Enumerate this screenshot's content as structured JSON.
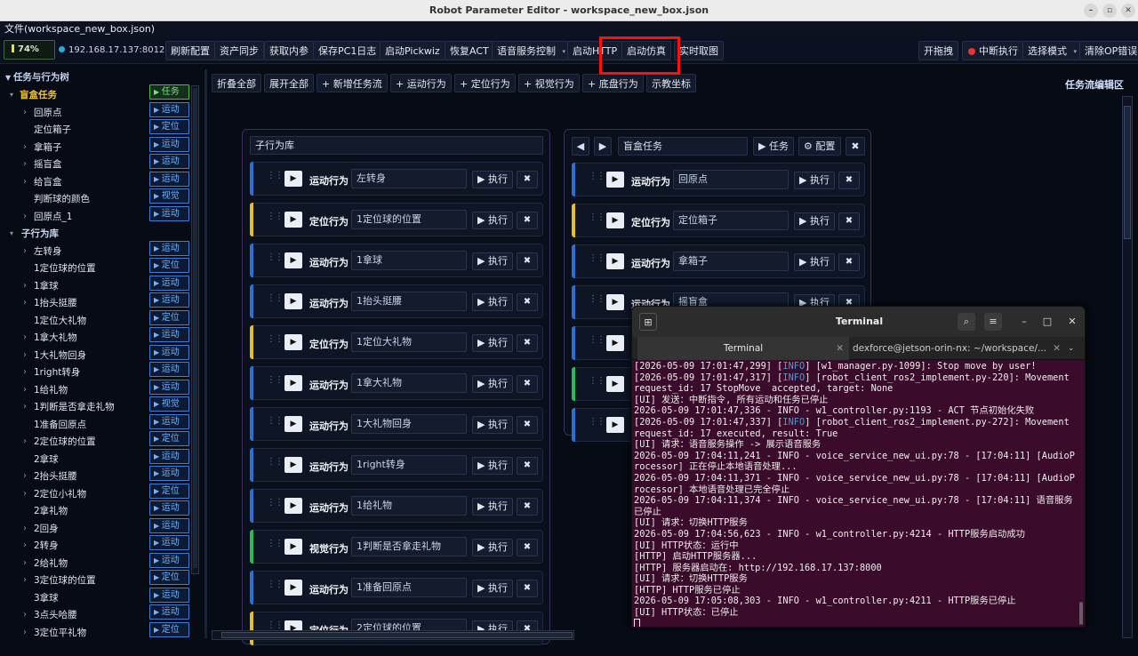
{
  "window": {
    "title": "Robot Parameter Editor - workspace_new_box.json"
  },
  "menu": {
    "file": "文件(workspace_new_box.json)"
  },
  "status": {
    "battery": "74%",
    "ip": "192.168.17.137:8012"
  },
  "toolbar": {
    "buttons": [
      "刷新配置",
      "资产同步",
      "获取内参",
      "保存PC1日志",
      "启动Pickwiz",
      "恢复ACT",
      "语音服务控制",
      "启动HTTP",
      "启动仿真",
      "实时取图"
    ],
    "right": [
      "开拖拽",
      "中断执行",
      "选择模式",
      "清除OP错误"
    ]
  },
  "tree": {
    "root": "任务与行为树",
    "rows": [
      {
        "label": "盲盒任务",
        "tag": "任务"
      },
      {
        "label": "回原点",
        "tag": "运动"
      },
      {
        "label": "定位箱子",
        "tag": "定位"
      },
      {
        "label": "拿箱子",
        "tag": "运动"
      },
      {
        "label": "摇盲盒",
        "tag": "运动"
      },
      {
        "label": "给盲盒",
        "tag": "运动"
      },
      {
        "label": "判断球的颜色",
        "tag": "视觉"
      },
      {
        "label": "回原点_1",
        "tag": "运动"
      },
      {
        "label": "子行为库",
        "tag": ""
      },
      {
        "label": "左转身",
        "tag": "运动"
      },
      {
        "label": "1定位球的位置",
        "tag": "定位"
      },
      {
        "label": "1拿球",
        "tag": "运动"
      },
      {
        "label": "1抬头挺腰",
        "tag": "运动"
      },
      {
        "label": "1定位大礼物",
        "tag": "定位"
      },
      {
        "label": "1拿大礼物",
        "tag": "运动"
      },
      {
        "label": "1大礼物回身",
        "tag": "运动"
      },
      {
        "label": "1right转身",
        "tag": "运动"
      },
      {
        "label": "1给礼物",
        "tag": "运动"
      },
      {
        "label": "1判断是否拿走礼物",
        "tag": "视觉"
      },
      {
        "label": "1准备回原点",
        "tag": "运动"
      },
      {
        "label": "2定位球的位置",
        "tag": "定位"
      },
      {
        "label": "2拿球",
        "tag": "运动"
      },
      {
        "label": "2抬头挺腰",
        "tag": "运动"
      },
      {
        "label": "2定位小礼物",
        "tag": "定位"
      },
      {
        "label": "2拿礼物",
        "tag": "运动"
      },
      {
        "label": "2回身",
        "tag": "运动"
      },
      {
        "label": "2转身",
        "tag": "运动"
      },
      {
        "label": "2给礼物",
        "tag": "运动"
      },
      {
        "label": "3定位球的位置",
        "tag": "定位"
      },
      {
        "label": "3拿球",
        "tag": "运动"
      },
      {
        "label": "3点头哈腰",
        "tag": "运动"
      },
      {
        "label": "3定位平礼物",
        "tag": "定位"
      }
    ]
  },
  "actions": {
    "buttons": [
      "折叠全部",
      "展开全部",
      "+ 新增任务流",
      "+ 运动行为",
      "+ 定位行为",
      "+ 视觉行为",
      "+ 底盘行为",
      "示教坐标"
    ],
    "editor_label": "任务流编辑区"
  },
  "lib": {
    "title": "子行为库",
    "exec": "▶ 执行",
    "x": "✖",
    "cards": [
      {
        "type": "运动行为",
        "name": "左转身",
        "color": "#2f6fd4"
      },
      {
        "type": "定位行为",
        "name": "1定位球的位置",
        "color": "#e2c02a"
      },
      {
        "type": "运动行为",
        "name": "1拿球",
        "color": "#2f6fd4"
      },
      {
        "type": "运动行为",
        "name": "1抬头挺腰",
        "color": "#2f6fd4"
      },
      {
        "type": "定位行为",
        "name": "1定位大礼物",
        "color": "#e2c02a"
      },
      {
        "type": "运动行为",
        "name": "1拿大礼物",
        "color": "#2f6fd4"
      },
      {
        "type": "运动行为",
        "name": "1大礼物回身",
        "color": "#2f6fd4"
      },
      {
        "type": "运动行为",
        "name": "1right转身",
        "color": "#2f6fd4"
      },
      {
        "type": "运动行为",
        "name": "1给礼物",
        "color": "#2f6fd4"
      },
      {
        "type": "视觉行为",
        "name": "1判断是否拿走礼物",
        "color": "#2fb85a"
      },
      {
        "type": "运动行为",
        "name": "1准备回原点",
        "color": "#2f6fd4"
      },
      {
        "type": "定位行为",
        "name": "2定位球的位置",
        "color": "#e2c02a"
      }
    ]
  },
  "task": {
    "title": "盲盒任务",
    "task_btn": "▶ 任务",
    "config_btn": "⚙ 配置",
    "prev": "◀",
    "next": "▶",
    "cards": [
      {
        "type": "运动行为",
        "name": "回原点",
        "color": "#2f6fd4"
      },
      {
        "type": "定位行为",
        "name": "定位箱子",
        "color": "#e2c02a"
      },
      {
        "type": "运动行为",
        "name": "拿箱子",
        "color": "#2f6fd4"
      },
      {
        "type": "运动行为",
        "name": "摇盲盒",
        "color": "#2f6fd4"
      },
      {
        "type": "",
        "name": "",
        "color": "#2f6fd4"
      },
      {
        "type": "",
        "name": "",
        "color": "#2fb85a"
      },
      {
        "type": "",
        "name": "",
        "color": "#2f6fd4"
      }
    ]
  },
  "terminal": {
    "title": "Terminal",
    "tab1": "Terminal",
    "tab2": "dexforce@jetson-orin-nx: ~/workspace/...",
    "lines": [
      [
        "[2026-05-09 17:01:47,299] [",
        "INFO",
        "] [w1_manager.py-1099]: Stop move by user!"
      ],
      [
        "[2026-05-09 17:01:47,317] [",
        "INFO",
        "] [robot_client_ros2_implement.py-220]: Movement request_id: 17 StopMove  accepted, target: None"
      ],
      [
        "[UI] 发送：中断指令, 所有运动和任务已停止"
      ],
      [
        "2026-05-09 17:01:47,336 - INFO - w1_controller.py:1193 - ACT 节点初始化失败"
      ],
      [
        "[2026-05-09 17:01:47,337] [",
        "INFO",
        "] [robot_client_ros2_implement.py-272]: Movement request_id: 17 executed, result: True"
      ],
      [
        "[UI] 请求：语音服务操作 -> 展示语音服务"
      ],
      [
        "2026-05-09 17:04:11,241 - INFO - voice_service_new_ui.py:78 - [17:04:11] [AudioProcessor] 正在停止本地语音处理..."
      ],
      [
        "2026-05-09 17:04:11,371 - INFO - voice_service_new_ui.py:78 - [17:04:11] [AudioProcessor] 本地语音处理已完全停止"
      ],
      [
        "2026-05-09 17:04:11,374 - INFO - voice_service_new_ui.py:78 - [17:04:11] 语音服务已停止"
      ],
      [
        "[UI] 请求：切换HTTP服务"
      ],
      [
        "2026-05-09 17:04:56,623 - INFO - w1_controller.py:4214 - HTTP服务启动成功"
      ],
      [
        "[UI] HTTP状态：运行中"
      ],
      [
        "[HTTP] 启动HTTP服务器..."
      ],
      [
        "[HTTP] 服务器启动在: http://192.168.17.137:8000"
      ],
      [
        "[UI] 请求：切换HTTP服务"
      ],
      [
        "[HTTP] HTTP服务已停止"
      ],
      [
        "2026-05-09 17:05:08,303 - INFO - w1_controller.py:4211 - HTTP服务已停止"
      ],
      [
        "[UI] HTTP状态：已停止"
      ]
    ]
  }
}
